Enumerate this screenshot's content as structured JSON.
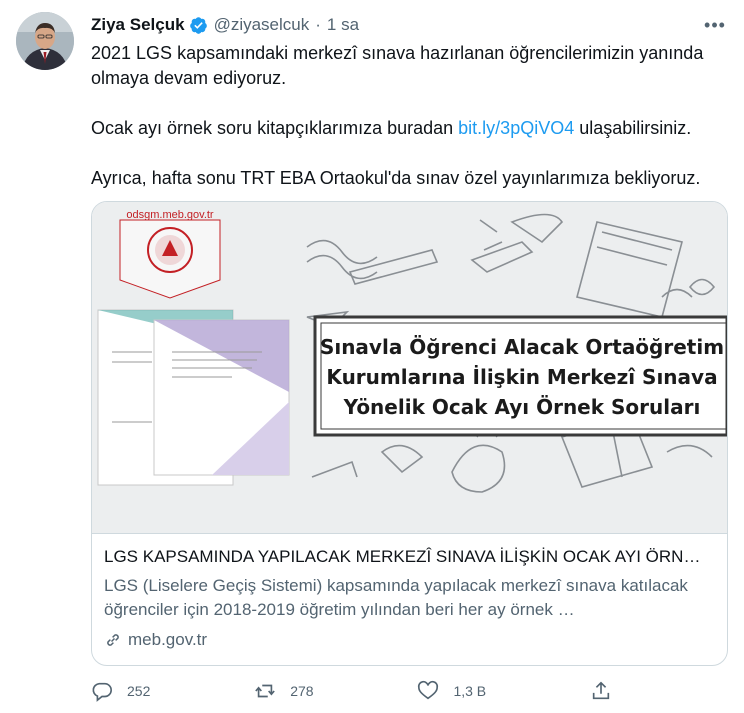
{
  "tweet": {
    "author_name": "Ziya Selçuk",
    "handle": "@ziyaselcuk",
    "separator": "·",
    "time": "1 sa",
    "more_label": "•••",
    "paragraphs": [
      {
        "text": "2021 LGS kapsamındaki merkezî sınava hazırlanan öğrencilerimizin yanında olmaya devam ediyoruz."
      },
      {
        "before": "Ocak ayı örnek soru kitapçıklarımıza buradan ",
        "link": "bit.ly/3pQiVO4",
        "after": " ulaşabilirsiniz."
      },
      {
        "text": "Ayrıca, hafta sonu TRT EBA Ortaokul'da sınav özel yayınlarımıza bekliyoruz."
      }
    ]
  },
  "card": {
    "image": {
      "site_label": "odsgm.meb.gov.tr",
      "headline_lines": [
        "Sınavla Öğrenci Alacak Ortaöğretim",
        "Kurumlarına İlişkin Merkezî Sınava",
        "Yönelik Ocak Ayı Örnek Soruları"
      ],
      "colors": {
        "banner": "#c32025",
        "doc_front": "#b7a9d6",
        "doc_back": "#6ab8b3",
        "frame": "#3a3a3a"
      }
    },
    "title": "LGS KAPSAMINDA YAPILACAK MERKEZÎ SINAVA İLİŞKİN OCAK AYI ÖRN…",
    "description": "LGS (Liselere Geçiş Sistemi) kapsamında yapılacak merkezî sınava katılacak öğrenciler için 2018-2019 öğretim yılından beri her ay örnek …",
    "domain": "meb.gov.tr",
    "domain_icon": "link-icon"
  },
  "actions": {
    "reply_count": "252",
    "retweet_count": "278",
    "like_count": "1,3 B",
    "icons": [
      "reply-icon",
      "retweet-icon",
      "like-icon",
      "share-icon"
    ]
  },
  "colors": {
    "accent": "#1d9bf0",
    "text": "#0f1419",
    "secondary": "#536471",
    "border": "#cfd9de"
  }
}
